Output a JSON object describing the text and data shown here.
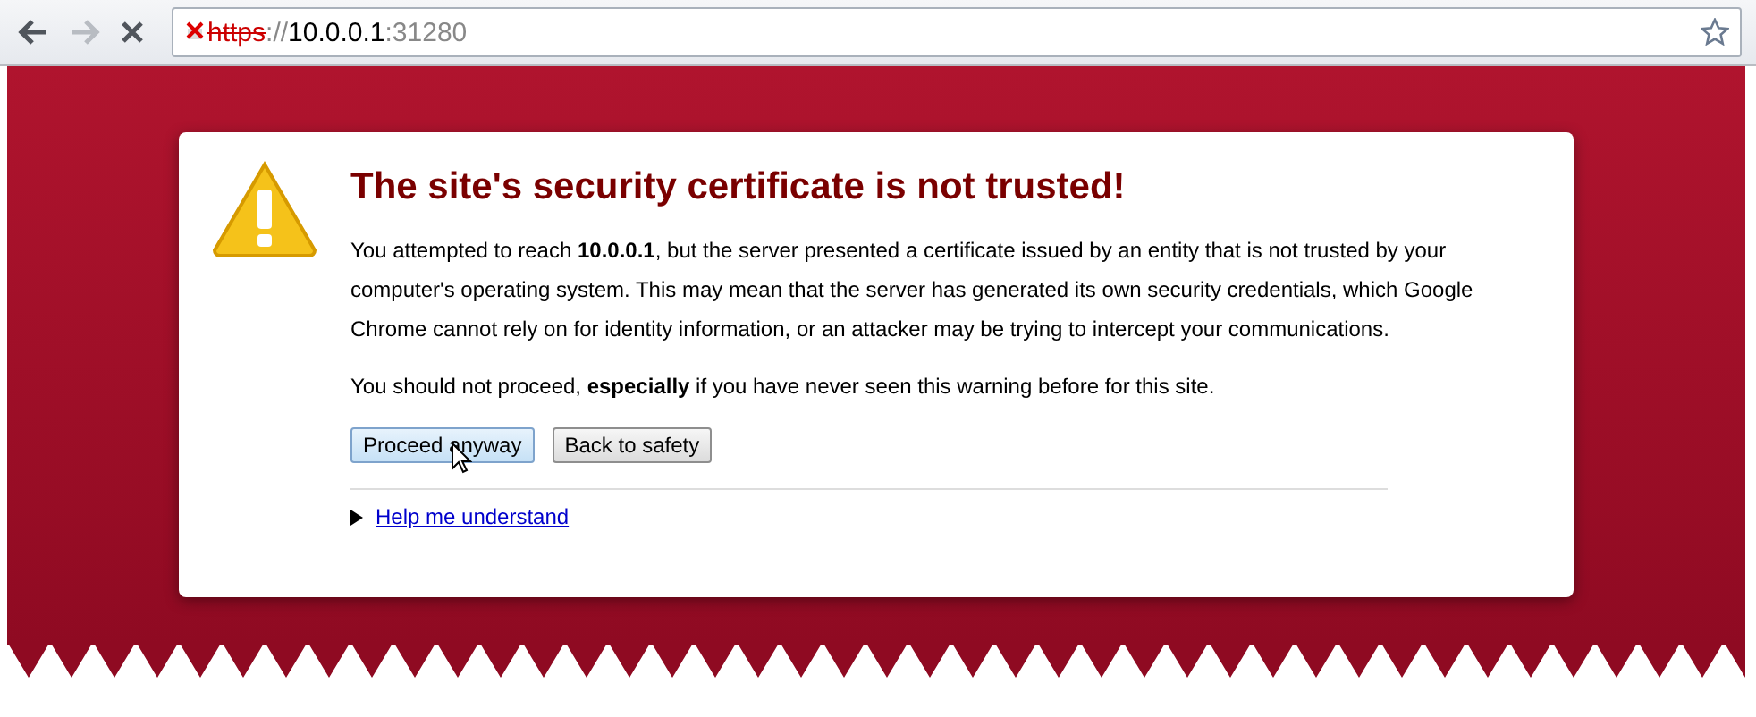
{
  "address": {
    "scheme": "https",
    "separator": "://",
    "host": "10.0.0.1",
    "port": ":31280",
    "insecure": true
  },
  "navigation": {
    "back_disabled": false,
    "forward_disabled": true
  },
  "title": "The site's security certificate is not trusted!",
  "paragraphs": [
    "You attempted to reach **10.0.0.1**, but the server presented a certificate issued by an entity that is not trusted by your computer's operating system. This may mean that the server has generated its own security credentials, which Google Chrome cannot rely on for identity information, or an attacker may be trying to intercept your communications.",
    "You should not proceed, **especially** if you have never seen this warning before for this site."
  ],
  "buttons": [
    {
      "label": "Proceed anyway",
      "hovered": true
    },
    {
      "label": "Back to safety",
      "hovered": false
    }
  ],
  "help_link": {
    "label": "Help me understand",
    "expanded": false
  }
}
